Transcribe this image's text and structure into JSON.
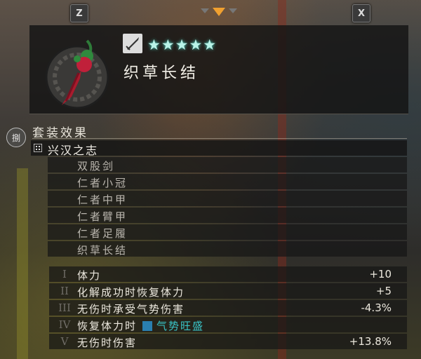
{
  "controls": {
    "left_key": "Z",
    "right_key": "X"
  },
  "item": {
    "name": "织草长结",
    "stars": "★★★★★",
    "icon": "sword-icon",
    "accent_color": "#4de6d4"
  },
  "set": {
    "section_title": "套装效果",
    "badge": "捌",
    "name": "兴汉之志",
    "pieces": [
      "双股剑",
      "仁者小冠",
      "仁者中甲",
      "仁者臂甲",
      "仁者足履",
      "织草长结"
    ]
  },
  "stats": [
    {
      "num": "I",
      "name": "体力",
      "value": "+10"
    },
    {
      "num": "II",
      "name": "化解成功时恢复体力",
      "value": "+5"
    },
    {
      "num": "III",
      "name": "无伤时承受气势伤害",
      "value": "-4.3%"
    },
    {
      "num": "IV",
      "name": "恢复体力时",
      "spirit": "气势旺盛",
      "value": ""
    },
    {
      "num": "V",
      "name": "无伤时伤害",
      "value": "+13.8%"
    }
  ]
}
